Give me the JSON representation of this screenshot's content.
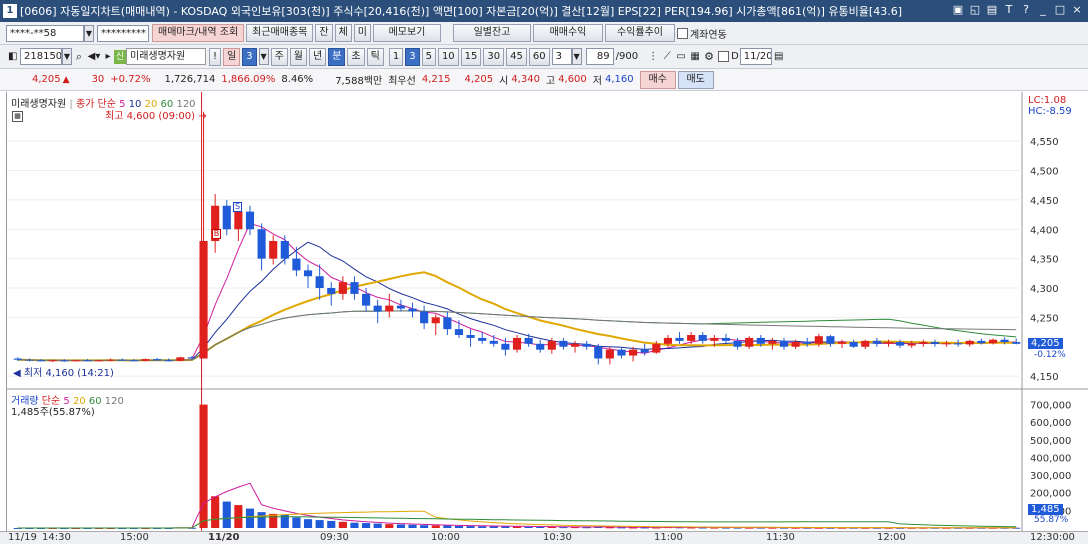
{
  "titlebar": {
    "badge": "1",
    "title": "[0606] 자동일지차트(매매내역) - KOSDAQ 외국인보유[303(천)] 주식수[20,416(천)] 액면[100] 자본금[20(억)] 결산[12월] EPS[22] PER[194.96] 시가총액[861(억)] 유통비율[43.6]",
    "icons": [
      "▣",
      "◱",
      "▤",
      "T",
      "?",
      "_",
      "□",
      "×"
    ]
  },
  "toolbar1": {
    "account": "****-**58",
    "password": "*********",
    "buttons": [
      "매매마크/내역 조회",
      "최근매매종목",
      "잔",
      "체",
      "미",
      "메모보기",
      "일별잔고",
      "매매수익",
      "수익률추이"
    ],
    "link_label": "계좌연동"
  },
  "toolbar2": {
    "code": "218150",
    "stock_name": "미래생명자원",
    "period_buttons": [
      "!",
      "일",
      "3",
      "주",
      "월",
      "년",
      "분",
      "초",
      "틱",
      "1",
      "3",
      "5",
      "10",
      "15",
      "30",
      "45",
      "60",
      "3"
    ],
    "count": "89",
    "count_total": "/900",
    "date": "11/20"
  },
  "quote": {
    "price": "4,205",
    "change": "30",
    "change_pct": "+0.72%",
    "volume": "1,726,714",
    "vol_ratio": "1,866.09%",
    "turnover": "8.46%",
    "amount": "7,588백만",
    "best_label": "최우선",
    "ask": "4,215",
    "bid": "4,205",
    "open_label": "시",
    "open": "4,340",
    "high_label": "고",
    "high": "4,600",
    "low_label": "저",
    "low": "4,160",
    "buy_btn": "매수",
    "sell_btn": "매도"
  },
  "price_panel": {
    "stock_label": "미래생명자원",
    "ma_label": "종가 단순",
    "ma_periods": [
      "5",
      "10",
      "20",
      "60",
      "120"
    ],
    "high_note": "최고 4,600 (09:00)",
    "low_note": "최저 4,160 (14:21)",
    "lc": "LC:1.08",
    "hc": "HC:-8.59",
    "y_ticks": [
      "4,550",
      "4,500",
      "4,450",
      "4,400",
      "4,350",
      "4,300",
      "4,250",
      "4,150"
    ],
    "current_price": "4,205",
    "current_pct": "-0.12%",
    "marker_buy": "B",
    "marker_sell": "S"
  },
  "volume_panel": {
    "label": "거래량",
    "ma_label": "단순",
    "ma_periods": [
      "5",
      "20",
      "60",
      "120"
    ],
    "info": "1,485주(55.87%)",
    "y_ticks": [
      "700,000",
      "600,000",
      "500,000",
      "400,000",
      "300,000",
      "200,000",
      "100,000"
    ],
    "current": "1,485",
    "current_pct": "55.87%"
  },
  "x_axis": [
    "11/19",
    "14:30",
    "15:00",
    "11/20",
    "09:30",
    "10:00",
    "10:30",
    "11:00",
    "11:30",
    "12:00",
    "12:30:00"
  ],
  "colors": {
    "up": "#e0201c",
    "down": "#1f5bd8",
    "ma5": "#d01c9c",
    "ma10": "#1c2f9c",
    "ma20": "#e0a800",
    "ma60": "#2e8b3a",
    "ma120": "#777777"
  },
  "chart_data": {
    "type": "candlestick",
    "ylim": [
      4140,
      4620
    ],
    "candles": [
      [
        4180,
        4182,
        4176,
        4178
      ],
      [
        4178,
        4180,
        4175,
        4177
      ],
      [
        4177,
        4179,
        4175,
        4176
      ],
      [
        4176,
        4178,
        4174,
        4177
      ],
      [
        4177,
        4179,
        4174,
        4176
      ],
      [
        4176,
        4178,
        4175,
        4177
      ],
      [
        4177,
        4179,
        4175,
        4176
      ],
      [
        4176,
        4178,
        4175,
        4177
      ],
      [
        4177,
        4180,
        4175,
        4178
      ],
      [
        4178,
        4180,
        4176,
        4177
      ],
      [
        4177,
        4179,
        4175,
        4176
      ],
      [
        4176,
        4180,
        4175,
        4179
      ],
      [
        4179,
        4181,
        4176,
        4177
      ],
      [
        4177,
        4180,
        4175,
        4176
      ],
      [
        4176,
        4183,
        4175,
        4182
      ],
      [
        4182,
        4184,
        4178,
        4180
      ],
      [
        4180,
        4600,
        4180,
        4380
      ],
      [
        4380,
        4460,
        4360,
        4440
      ],
      [
        4440,
        4450,
        4390,
        4400
      ],
      [
        4400,
        4440,
        4380,
        4430
      ],
      [
        4430,
        4440,
        4390,
        4400
      ],
      [
        4400,
        4410,
        4330,
        4350
      ],
      [
        4350,
        4390,
        4340,
        4380
      ],
      [
        4380,
        4390,
        4340,
        4350
      ],
      [
        4350,
        4370,
        4320,
        4330
      ],
      [
        4330,
        4340,
        4300,
        4320
      ],
      [
        4320,
        4340,
        4280,
        4300
      ],
      [
        4300,
        4310,
        4270,
        4290
      ],
      [
        4290,
        4320,
        4280,
        4310
      ],
      [
        4310,
        4320,
        4280,
        4290
      ],
      [
        4290,
        4300,
        4260,
        4270
      ],
      [
        4270,
        4280,
        4240,
        4260
      ],
      [
        4260,
        4290,
        4250,
        4270
      ],
      [
        4270,
        4280,
        4260,
        4265
      ],
      [
        4265,
        4275,
        4250,
        4260
      ],
      [
        4260,
        4270,
        4230,
        4240
      ],
      [
        4240,
        4255,
        4220,
        4250
      ],
      [
        4250,
        4260,
        4220,
        4230
      ],
      [
        4230,
        4245,
        4215,
        4220
      ],
      [
        4220,
        4230,
        4200,
        4215
      ],
      [
        4215,
        4225,
        4205,
        4210
      ],
      [
        4210,
        4220,
        4200,
        4205
      ],
      [
        4205,
        4215,
        4185,
        4195
      ],
      [
        4195,
        4220,
        4190,
        4215
      ],
      [
        4215,
        4222,
        4200,
        4205
      ],
      [
        4205,
        4212,
        4190,
        4195
      ],
      [
        4195,
        4215,
        4188,
        4210
      ],
      [
        4210,
        4215,
        4195,
        4200
      ],
      [
        4200,
        4210,
        4190,
        4205
      ],
      [
        4205,
        4210,
        4195,
        4200
      ],
      [
        4200,
        4205,
        4170,
        4180
      ],
      [
        4180,
        4200,
        4170,
        4195
      ],
      [
        4195,
        4198,
        4180,
        4185
      ],
      [
        4185,
        4200,
        4175,
        4195
      ],
      [
        4195,
        4205,
        4185,
        4190
      ],
      [
        4190,
        4210,
        4188,
        4205
      ],
      [
        4205,
        4220,
        4200,
        4215
      ],
      [
        4215,
        4225,
        4205,
        4210
      ],
      [
        4210,
        4225,
        4205,
        4220
      ],
      [
        4220,
        4225,
        4205,
        4210
      ],
      [
        4210,
        4220,
        4200,
        4215
      ],
      [
        4215,
        4222,
        4205,
        4210
      ],
      [
        4210,
        4215,
        4195,
        4200
      ],
      [
        4200,
        4218,
        4196,
        4215
      ],
      [
        4215,
        4220,
        4200,
        4205
      ],
      [
        4205,
        4215,
        4195,
        4210
      ],
      [
        4210,
        4215,
        4195,
        4200
      ],
      [
        4200,
        4212,
        4196,
        4208
      ],
      [
        4208,
        4215,
        4200,
        4205
      ],
      [
        4205,
        4222,
        4200,
        4218
      ],
      [
        4218,
        4220,
        4200,
        4205
      ],
      [
        4205,
        4212,
        4198,
        4208
      ],
      [
        4208,
        4212,
        4198,
        4200
      ],
      [
        4200,
        4212,
        4196,
        4210
      ],
      [
        4210,
        4215,
        4200,
        4205
      ],
      [
        4205,
        4212,
        4200,
        4208
      ],
      [
        4208,
        4212,
        4198,
        4202
      ],
      [
        4202,
        4210,
        4198,
        4205
      ],
      [
        4205,
        4212,
        4200,
        4208
      ],
      [
        4208,
        4212,
        4200,
        4205
      ],
      [
        4205,
        4210,
        4200,
        4206
      ],
      [
        4206,
        4212,
        4200,
        4204
      ],
      [
        4204,
        4212,
        4200,
        4210
      ],
      [
        4210,
        4214,
        4204,
        4206
      ],
      [
        4206,
        4214,
        4204,
        4212
      ],
      [
        4212,
        4216,
        4204,
        4208
      ],
      [
        4208,
        4214,
        4204,
        4205
      ]
    ],
    "volume": [
      200,
      150,
      120,
      180,
      200,
      150,
      130,
      170,
      160,
      140,
      150,
      200,
      180,
      160,
      3000,
      1200,
      700000,
      180000,
      150000,
      130000,
      110000,
      90000,
      80000,
      75000,
      60000,
      50000,
      45000,
      40000,
      35000,
      30000,
      28000,
      25000,
      22000,
      20000,
      18000,
      16000,
      15000,
      14000,
      12000,
      11000,
      10000,
      9000,
      12000,
      8000,
      7000,
      6000,
      8000,
      5000,
      5000,
      4500,
      9000,
      4000,
      3500,
      3000,
      3200,
      3000,
      5000,
      4000,
      3000,
      2800,
      2500,
      2400,
      2200,
      2000,
      2200,
      2000,
      1900,
      1800,
      1700,
      1600,
      1500,
      1600,
      1700,
      1500,
      1400,
      1500,
      1300,
      1400,
      1500,
      1400,
      1300,
      1400,
      1485,
      1500,
      1485,
      1400,
      1485
    ],
    "vylim": [
      0,
      760000
    ]
  }
}
